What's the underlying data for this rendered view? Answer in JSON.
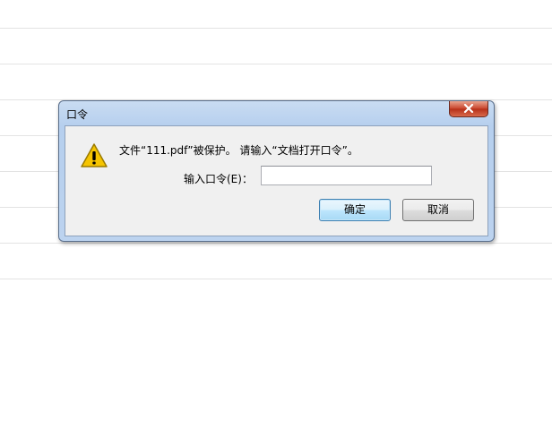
{
  "dialog": {
    "title": "口令",
    "message": "文件“111.pdf”被保护。 请输入“文档打开口令”。",
    "password_label": "输入口令(E)：",
    "password_value": "",
    "ok_label": "确定",
    "cancel_label": "取消"
  },
  "icons": {
    "close": "close-icon",
    "warning": "warning-icon"
  },
  "colors": {
    "titlebar": "#bcd3ef",
    "close_button": "#c8432b",
    "warning_fill": "#f5c400",
    "ok_border": "#3c7fb1"
  }
}
